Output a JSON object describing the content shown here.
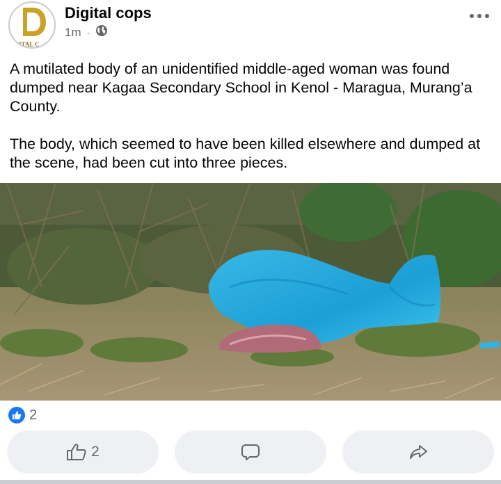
{
  "post": {
    "author": "Digital cops",
    "time": "1m",
    "separator": "·",
    "privacy_icon": "globe-icon",
    "avatar_letter": "D",
    "avatar_text": "ITAL C",
    "paragraphs": [
      "A mutilated body of an unidentified middle-aged woman was found dumped near Kagaa Secondary School in Kenol - Maragua, Murang’a County.",
      "The body, which seemed to have been killed elsewhere and dumped at the scene, had been cut into three pieces."
    ]
  },
  "reactions": {
    "icon": "like-badge-icon",
    "count": "2"
  },
  "actions": {
    "like_icon": "thumbs-up-icon",
    "like_count": "2",
    "comment_icon": "comment-icon",
    "share_icon": "share-icon"
  },
  "colors": {
    "accent": "#1877f2",
    "muted_text": "#65676b",
    "button_bg": "#eef0f3",
    "logo_gold": "#c9a227"
  }
}
